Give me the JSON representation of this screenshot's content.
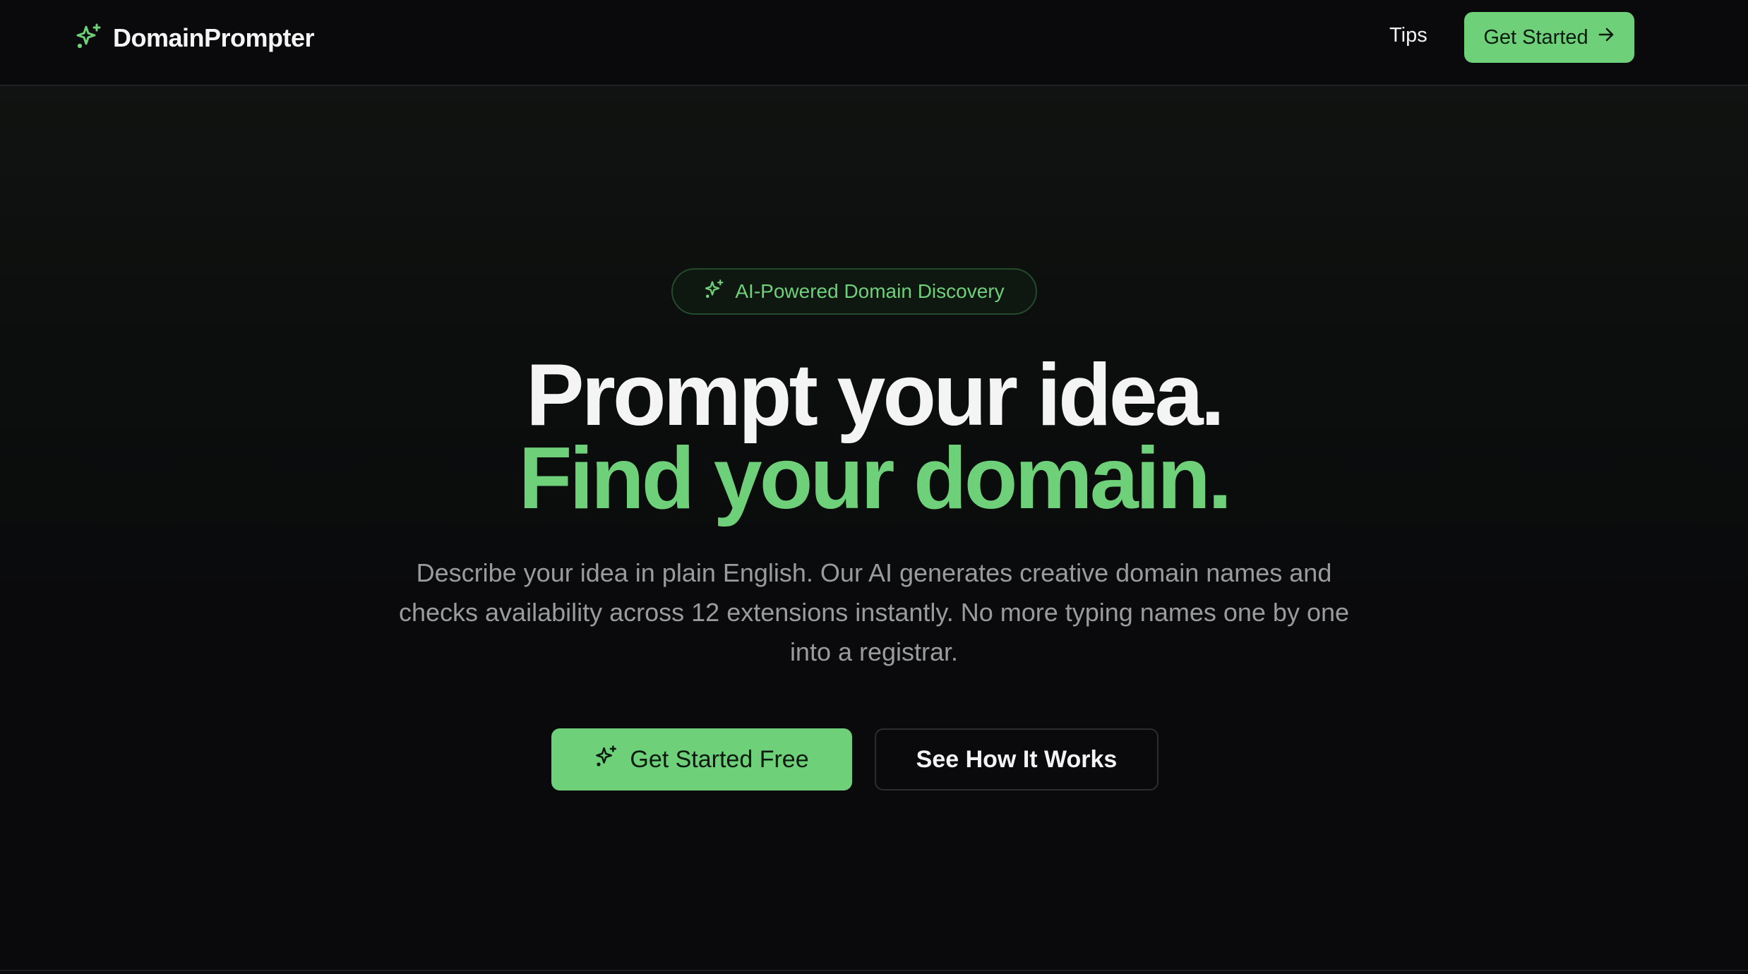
{
  "header": {
    "brand_name": "DomainPrompter",
    "nav_tips": "Tips",
    "cta_label": "Get Started"
  },
  "hero": {
    "badge_text": "AI-Powered Domain Discovery",
    "headline_line1": "Prompt your idea.",
    "headline_line2": "Find your domain.",
    "description": "Describe your idea in plain English. Our AI generates creative domain names and checks availability across 12 extensions instantly. No more typing names one by one into a registrar.",
    "primary_button": "Get Started Free",
    "secondary_button": "See How It Works"
  },
  "icons": {
    "brand": "sparkles-icon",
    "cta": "arrow-right-icon",
    "badge": "sparkles-icon",
    "primary_button": "sparkles-icon"
  },
  "colors": {
    "accent": "#6fd07a",
    "background": "#0a0a0c",
    "text_primary": "#f4f4f4",
    "text_muted": "#9a9c9b"
  }
}
